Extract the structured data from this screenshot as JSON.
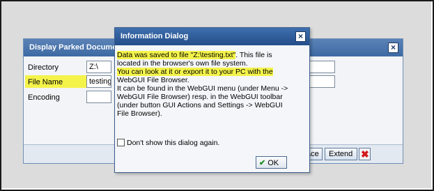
{
  "background_dialog": {
    "title": "Display Parked Docume",
    "close_symbol": "×",
    "rows": [
      {
        "label": "Directory",
        "value": "Z:\\"
      },
      {
        "label": "File Name",
        "value": "testing.t"
      },
      {
        "label": "Encoding",
        "value": ""
      }
    ],
    "buttons": {
      "replace_label": "ace",
      "extend_label": "Extend",
      "cancel_symbol": "✖"
    }
  },
  "info_dialog": {
    "title": "Information Dialog",
    "close_symbol": "×",
    "message_lines": [
      "Data was saved to file \"Z:\\testing.txt\". This file is",
      "located in the browser's own file system.",
      "You can look at it or export it to your PC with the",
      "WebGUI File Browser.",
      "It can be found in the WebGUI menu (under Menu ->",
      "WebGUI File Browser) resp. in the WebGUI toolbar",
      "(under button GUI Actions and Settings -> WebGUI",
      "File Browser)."
    ],
    "message_line1_highlight": "Data was saved to file \"Z:\\testing.txt\"",
    "message_line1_rest": ". This file is",
    "checkbox_label": "Don't show this dialog again.",
    "ok_label": "OK",
    "ok_icon": "✔"
  },
  "colors": {
    "highlight": "#f4f34a",
    "title_bar": "#234e8a",
    "cancel_red": "#d31a1a",
    "ok_green": "#1e8a1e"
  }
}
